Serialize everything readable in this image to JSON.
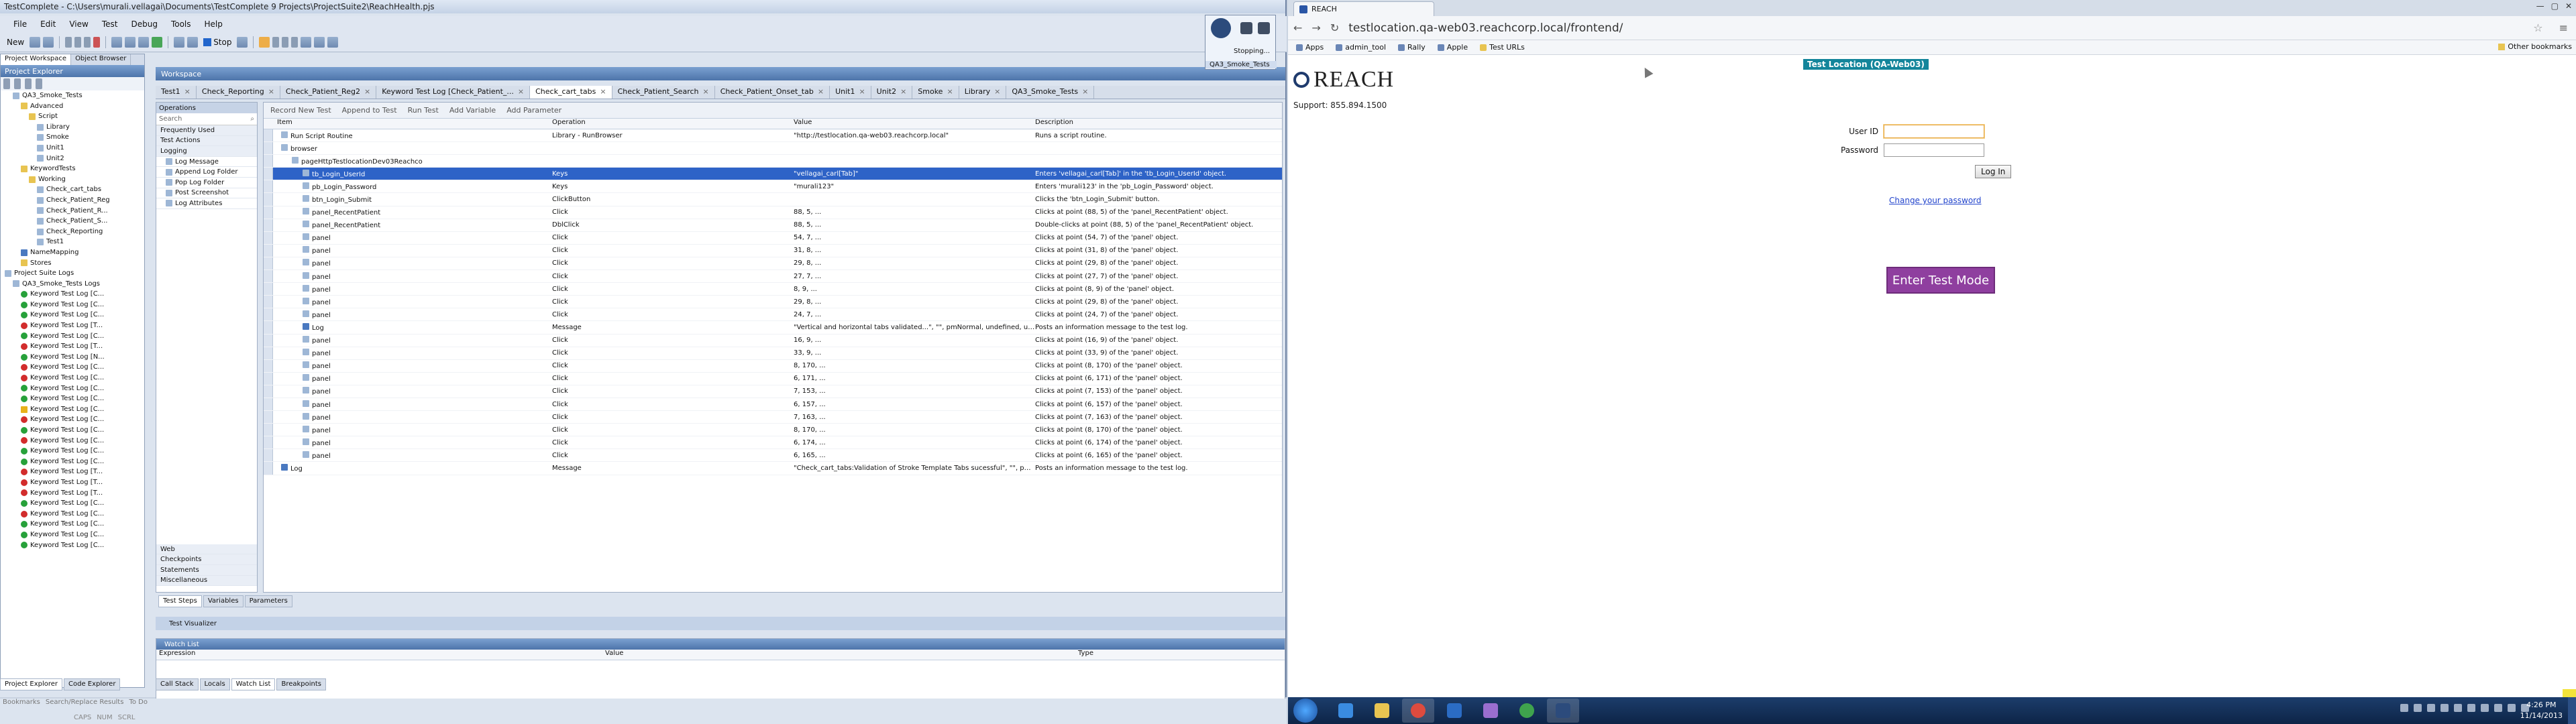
{
  "tc": {
    "title": "TestComplete - C:\\Users\\murali.vellagai\\Documents\\TestComplete 9 Projects\\ProjectSuite2\\ReachHealth.pjs",
    "menu": [
      "File",
      "Edit",
      "View",
      "Test",
      "Debug",
      "Tools",
      "Help"
    ],
    "toolbar": {
      "new_label": "New",
      "stop_label": "Stop"
    },
    "project_explorer": {
      "tabs": [
        "Project Workspace",
        "Object Browser"
      ],
      "header": "Project Explorer",
      "tree": [
        {
          "label": "QA3_Smoke_Tests",
          "indent": 1,
          "icon": "doc"
        },
        {
          "label": "Advanced",
          "indent": 2,
          "icon": "folder"
        },
        {
          "label": "Script",
          "indent": 3,
          "icon": "folder"
        },
        {
          "label": "Library",
          "indent": 4,
          "icon": "doc"
        },
        {
          "label": "Smoke",
          "indent": 4,
          "icon": "doc"
        },
        {
          "label": "Unit1",
          "indent": 4,
          "icon": "doc"
        },
        {
          "label": "Unit2",
          "indent": 4,
          "icon": "doc"
        },
        {
          "label": "KeywordTests",
          "indent": 2,
          "icon": "folder"
        },
        {
          "label": "Working",
          "indent": 3,
          "icon": "folder"
        },
        {
          "label": "Check_cart_tabs",
          "indent": 4,
          "icon": "doc"
        },
        {
          "label": "Check_Patient_Reg",
          "indent": 4,
          "icon": "doc"
        },
        {
          "label": "Check_Patient_R...",
          "indent": 4,
          "icon": "doc"
        },
        {
          "label": "Check_Patient_S...",
          "indent": 4,
          "icon": "doc"
        },
        {
          "label": "Check_Reporting",
          "indent": 4,
          "icon": "doc"
        },
        {
          "label": "Test1",
          "indent": 4,
          "icon": "doc"
        },
        {
          "label": "NameMapping",
          "indent": 2,
          "icon": "blue"
        },
        {
          "label": "Stores",
          "indent": 2,
          "icon": "folder"
        },
        {
          "label": "Project Suite Logs",
          "indent": 0,
          "icon": "doc"
        },
        {
          "label": "QA3_Smoke_Tests Logs",
          "indent": 1,
          "icon": "doc"
        },
        {
          "label": "Keyword Test Log [C...",
          "indent": 2,
          "icon": "ok"
        },
        {
          "label": "Keyword Test Log [C...",
          "indent": 2,
          "icon": "ok"
        },
        {
          "label": "Keyword Test Log [C...",
          "indent": 2,
          "icon": "ok"
        },
        {
          "label": "Keyword Test Log [T...",
          "indent": 2,
          "icon": "err"
        },
        {
          "label": "Keyword Test Log [C...",
          "indent": 2,
          "icon": "ok"
        },
        {
          "label": "Keyword Test Log [T...",
          "indent": 2,
          "icon": "err"
        },
        {
          "label": "Keyword Test Log [N...",
          "indent": 2,
          "icon": "ok"
        },
        {
          "label": "Keyword Test Log [C...",
          "indent": 2,
          "icon": "err"
        },
        {
          "label": "Keyword Test Log [C...",
          "indent": 2,
          "icon": "err"
        },
        {
          "label": "Keyword Test Log [C...",
          "indent": 2,
          "icon": "ok"
        },
        {
          "label": "Keyword Test Log [C...",
          "indent": 2,
          "icon": "ok"
        },
        {
          "label": "Keyword Test Log [C...",
          "indent": 2,
          "icon": "warn"
        },
        {
          "label": "Keyword Test Log [C...",
          "indent": 2,
          "icon": "err"
        },
        {
          "label": "Keyword Test Log [C...",
          "indent": 2,
          "icon": "ok"
        },
        {
          "label": "Keyword Test Log [C...",
          "indent": 2,
          "icon": "err"
        },
        {
          "label": "Keyword Test Log [C...",
          "indent": 2,
          "icon": "ok"
        },
        {
          "label": "Keyword Test Log [C...",
          "indent": 2,
          "icon": "ok"
        },
        {
          "label": "Keyword Test Log [T...",
          "indent": 2,
          "icon": "err"
        },
        {
          "label": "Keyword Test Log [T...",
          "indent": 2,
          "icon": "err"
        },
        {
          "label": "Keyword Test Log [T...",
          "indent": 2,
          "icon": "err"
        },
        {
          "label": "Keyword Test Log [C...",
          "indent": 2,
          "icon": "ok"
        },
        {
          "label": "Keyword Test Log [C...",
          "indent": 2,
          "icon": "err"
        },
        {
          "label": "Keyword Test Log [C...",
          "indent": 2,
          "icon": "ok"
        },
        {
          "label": "Keyword Test Log [C...",
          "indent": 2,
          "icon": "ok"
        },
        {
          "label": "Keyword Test Log [C...",
          "indent": 2,
          "icon": "ok"
        }
      ]
    },
    "workspace": {
      "title": "Workspace",
      "tabs": [
        "Test1",
        "Check_Reporting",
        "Check_Patient_Reg2",
        "Keyword Test Log [Check_Patient_...",
        "Check_cart_tabs",
        "Check_Patient_Search",
        "Check_Patient_Onset_tab",
        "Unit1",
        "Unit2",
        "Smoke",
        "Library",
        "QA3_Smoke_Tests"
      ],
      "active_tab": 4
    },
    "operations": {
      "header": "Operations",
      "search_placeholder": "Search",
      "groups": [
        "Frequently Used",
        "Test Actions",
        "Logging"
      ],
      "logging_items": [
        "Log Message",
        "Append Log Folder",
        "Pop Log Folder",
        "Post Screenshot",
        "Log Attributes"
      ],
      "bottom_groups": [
        "Web",
        "Checkpoints",
        "Statements",
        "Miscellaneous"
      ]
    },
    "grid": {
      "toolbar": [
        "Record New Test",
        "Append to Test",
        "Run Test",
        "Add Variable",
        "Add Parameter"
      ],
      "headers": [
        "Item",
        "Operation",
        "Value",
        "Description"
      ],
      "rows": [
        {
          "item": "Run Script Routine",
          "op": "Library - RunBrowser",
          "val": "\"http://testlocation.qa-web03.reachcorp.local\"",
          "desc": "Runs a script routine.",
          "lvl": 1
        },
        {
          "item": "browser",
          "op": "",
          "val": "",
          "desc": "",
          "lvl": 1
        },
        {
          "item": "pageHttpTestlocationDev03Reachco",
          "op": "",
          "val": "",
          "desc": "",
          "lvl": 2
        },
        {
          "item": "tb_Login_UserId",
          "op": "Keys",
          "val": "\"vellagai_carl[Tab]\"",
          "desc": "Enters 'vellagai_carl[Tab]' in the 'tb_Login_UserId' object.",
          "lvl": 3,
          "sel": true
        },
        {
          "item": "pb_Login_Password",
          "op": "Keys",
          "val": "\"murali123\"",
          "desc": "Enters 'murali123' in the 'pb_Login_Password' object.",
          "lvl": 3
        },
        {
          "item": "btn_Login_Submit",
          "op": "ClickButton",
          "val": "",
          "desc": "Clicks the 'btn_Login_Submit' button.",
          "lvl": 3
        },
        {
          "item": "panel_RecentPatient",
          "op": "Click",
          "val": "88, 5, ...",
          "desc": "Clicks at point (88, 5) of the 'panel_RecentPatient' object.",
          "lvl": 3
        },
        {
          "item": "panel_RecentPatient",
          "op": "DblClick",
          "val": "88, 5, ...",
          "desc": "Double-clicks at point (88, 5) of the 'panel_RecentPatient' object.",
          "lvl": 3
        },
        {
          "item": "panel",
          "op": "Click",
          "val": "54, 7, ...",
          "desc": "Clicks at point (54, 7) of the 'panel' object.",
          "lvl": 3
        },
        {
          "item": "panel",
          "op": "Click",
          "val": "31, 8, ...",
          "desc": "Clicks at point (31, 8) of the 'panel' object.",
          "lvl": 3
        },
        {
          "item": "panel",
          "op": "Click",
          "val": "29, 8, ...",
          "desc": "Clicks at point (29, 8) of the 'panel' object.",
          "lvl": 3
        },
        {
          "item": "panel",
          "op": "Click",
          "val": "27, 7, ...",
          "desc": "Clicks at point (27, 7) of the 'panel' object.",
          "lvl": 3
        },
        {
          "item": "panel",
          "op": "Click",
          "val": "8, 9, ...",
          "desc": "Clicks at point (8, 9) of the 'panel' object.",
          "lvl": 3
        },
        {
          "item": "panel",
          "op": "Click",
          "val": "29, 8, ...",
          "desc": "Clicks at point (29, 8) of the 'panel' object.",
          "lvl": 3
        },
        {
          "item": "panel",
          "op": "Click",
          "val": "24, 7, ...",
          "desc": "Clicks at point (24, 7) of the 'panel' object.",
          "lvl": 3
        },
        {
          "item": "Log",
          "op": "Message",
          "val": "\"Vertical and horizontal tabs validated...\", \"\", pmNormal, undefined, und...",
          "desc": "Posts an information message to the test log.",
          "lvl": 3
        },
        {
          "item": "panel",
          "op": "Click",
          "val": "16, 9, ...",
          "desc": "Clicks at point (16, 9) of the 'panel' object.",
          "lvl": 3
        },
        {
          "item": "panel",
          "op": "Click",
          "val": "33, 9, ...",
          "desc": "Clicks at point (33, 9) of the 'panel' object.",
          "lvl": 3
        },
        {
          "item": "panel",
          "op": "Click",
          "val": "8, 170, ...",
          "desc": "Clicks at point (8, 170) of the 'panel' object.",
          "lvl": 3
        },
        {
          "item": "panel",
          "op": "Click",
          "val": "6, 171, ...",
          "desc": "Clicks at point (6, 171) of the 'panel' object.",
          "lvl": 3
        },
        {
          "item": "panel",
          "op": "Click",
          "val": "7, 153, ...",
          "desc": "Clicks at point (7, 153) of the 'panel' object.",
          "lvl": 3
        },
        {
          "item": "panel",
          "op": "Click",
          "val": "6, 157, ...",
          "desc": "Clicks at point (6, 157) of the 'panel' object.",
          "lvl": 3
        },
        {
          "item": "panel",
          "op": "Click",
          "val": "7, 163, ...",
          "desc": "Clicks at point (7, 163) of the 'panel' object.",
          "lvl": 3
        },
        {
          "item": "panel",
          "op": "Click",
          "val": "8, 170, ...",
          "desc": "Clicks at point (8, 170) of the 'panel' object.",
          "lvl": 3
        },
        {
          "item": "panel",
          "op": "Click",
          "val": "6, 174, ...",
          "desc": "Clicks at point (6, 174) of the 'panel' object.",
          "lvl": 3
        },
        {
          "item": "panel",
          "op": "Click",
          "val": "6, 165, ...",
          "desc": "Clicks at point (6, 165) of the 'panel' object.",
          "lvl": 3
        },
        {
          "item": "Log",
          "op": "Message",
          "val": "\"Check_cart_tabs:Validation of Stroke Template Tabs sucessful\", \"\", pm...",
          "desc": "Posts an information message to the test log.",
          "lvl": 1
        }
      ]
    },
    "bottom_tabs": [
      "Test Steps",
      "Variables",
      "Parameters"
    ],
    "test_visualizer": "Test Visualizer",
    "watch": {
      "title": "Watch List",
      "headers": [
        "Expression",
        "Value",
        "Type"
      ]
    },
    "dock_tabs": [
      "Call Stack",
      "Locals",
      "Watch List",
      "Breakpoints"
    ],
    "left_dock_tabs": [
      "Project Explorer",
      "Code Explorer"
    ],
    "status_tabs": [
      "Bookmarks",
      "Search/Replace Results",
      "To Do"
    ],
    "caps": [
      "CAPS",
      "NUM",
      "SCRL"
    ],
    "stopping": {
      "label": "Stopping...",
      "project": "QA3_Smoke_Tests"
    }
  },
  "browser": {
    "tab_title": "REACH",
    "window_controls": [
      "—",
      "▢",
      "✕"
    ],
    "url": "testlocation.qa-web03.reachcorp.local/frontend/",
    "bookmarks": [
      "Apps",
      "admin_tool",
      "Rally",
      "Apple",
      "Test URLs"
    ],
    "other_bookmarks": "Other bookmarks",
    "page": {
      "logo_text": "REACH",
      "support": "Support: 855.894.1500",
      "test_location": "Test Location (QA-Web03)",
      "user_id_label": "User ID",
      "password_label": "Password",
      "login_button": "Log In",
      "change_password": "Change your password",
      "enter_test_mode": "Enter Test Mode"
    }
  },
  "taskbar": {
    "apps": [
      "ie",
      "explorer",
      "chrome",
      "outlook",
      "pidgin",
      "chrome-2",
      "testcomplete"
    ],
    "time": "4:26 PM",
    "date": "11/14/2013"
  }
}
